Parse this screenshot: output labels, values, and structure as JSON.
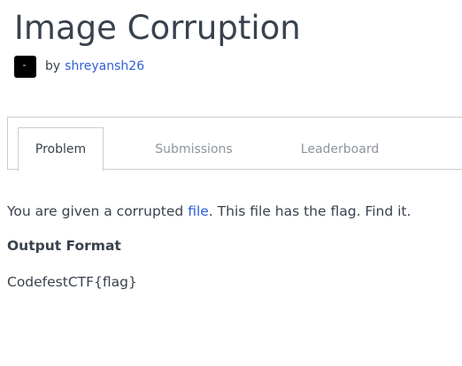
{
  "challenge": {
    "title": "Image Corruption",
    "by_label": "by",
    "author": "shreyansh26"
  },
  "tabs": [
    {
      "label": "Problem",
      "active": true
    },
    {
      "label": "Submissions",
      "active": false
    },
    {
      "label": "Leaderboard",
      "active": false
    }
  ],
  "problem": {
    "text_before": "You are given a corrupted ",
    "link_text": "file",
    "text_after": ". This file has the flag. Find it.",
    "output_heading": "Output Format",
    "output_value": "CodefestCTF{flag}"
  },
  "colors": {
    "link": "#2f5fd8",
    "text": "#39424e",
    "muted_tab": "#8e949c",
    "border": "#c9cdd3"
  }
}
